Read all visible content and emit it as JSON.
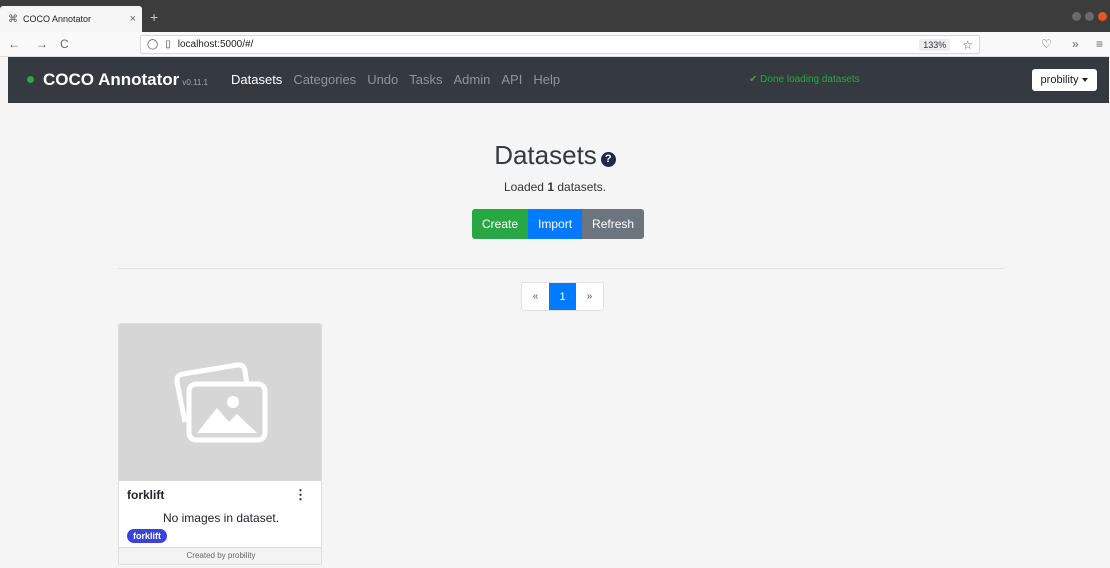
{
  "browser": {
    "tab_title": "COCO Annotator",
    "tab_close": "×",
    "new_tab": "+",
    "back": "←",
    "forward": "→",
    "reload": "C",
    "url": "localhost:5000/#/",
    "zoom": "133%",
    "overflow": "»",
    "menu": "≡"
  },
  "navbar": {
    "brand": "COCO Annotator",
    "version": "v0.11.1",
    "links": [
      "Datasets",
      "Categories",
      "Undo",
      "Tasks",
      "Admin",
      "API",
      "Help"
    ],
    "status": "✔ Done loading datasets",
    "user": "probility"
  },
  "page": {
    "title": "Datasets",
    "help_symbol": "?",
    "loaded_prefix": "Loaded ",
    "loaded_count": "1",
    "loaded_suffix": " datasets.",
    "buttons": {
      "create": "Create",
      "import": "Import",
      "refresh": "Refresh"
    },
    "pagination": {
      "first": "«",
      "current": "1",
      "last": "»"
    }
  },
  "datasets": [
    {
      "name": "forklift",
      "message": "No images in dataset.",
      "tag": "forklift",
      "footer": "Created by probility"
    }
  ]
}
